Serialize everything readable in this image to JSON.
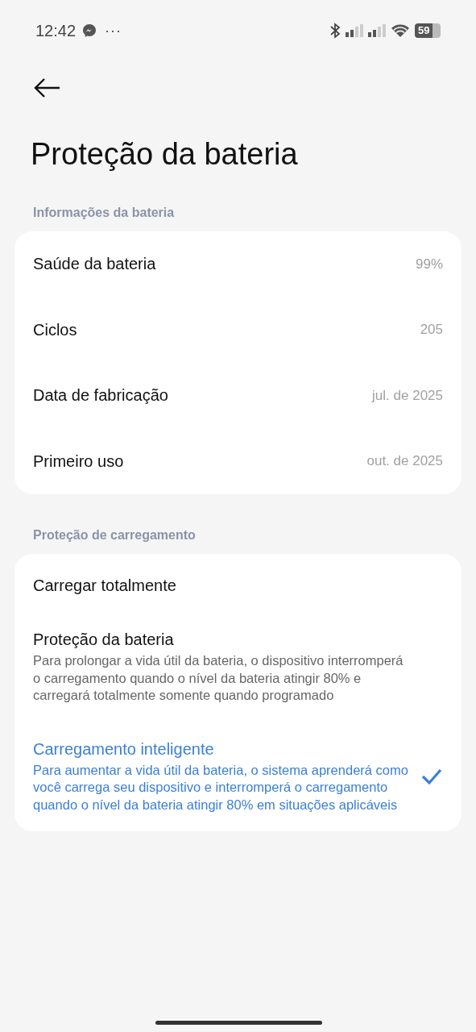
{
  "status_bar": {
    "time": "12:42",
    "more": "···",
    "battery": "59"
  },
  "title": "Proteção da bateria",
  "sections": [
    {
      "label": "Informações da bateria",
      "rows": [
        {
          "label": "Saúde da bateria",
          "value": "99%"
        },
        {
          "label": "Ciclos",
          "value": "205"
        },
        {
          "label": "Data de fabricação",
          "value": "jul. de 2025"
        },
        {
          "label": "Primeiro uso",
          "value": "out. de 2025"
        }
      ]
    },
    {
      "label": "Proteção de carregamento",
      "options": [
        {
          "title": "Carregar totalmente",
          "selected": false
        },
        {
          "title": "Proteção da bateria",
          "description": "Para prolongar a vida útil da bateria, o dispositivo interromperá o carregamento quando o nível da bateria atingir 80% e carregará totalmente somente quando programado",
          "selected": false
        },
        {
          "title": "Carregamento inteligente",
          "description": "Para aumentar a vida útil da bateria, o sistema aprenderá como você carrega seu dispositivo e interromperá o carregamento quando o nível da bateria atingir 80% em situações aplicáveis",
          "selected": true
        }
      ]
    }
  ]
}
